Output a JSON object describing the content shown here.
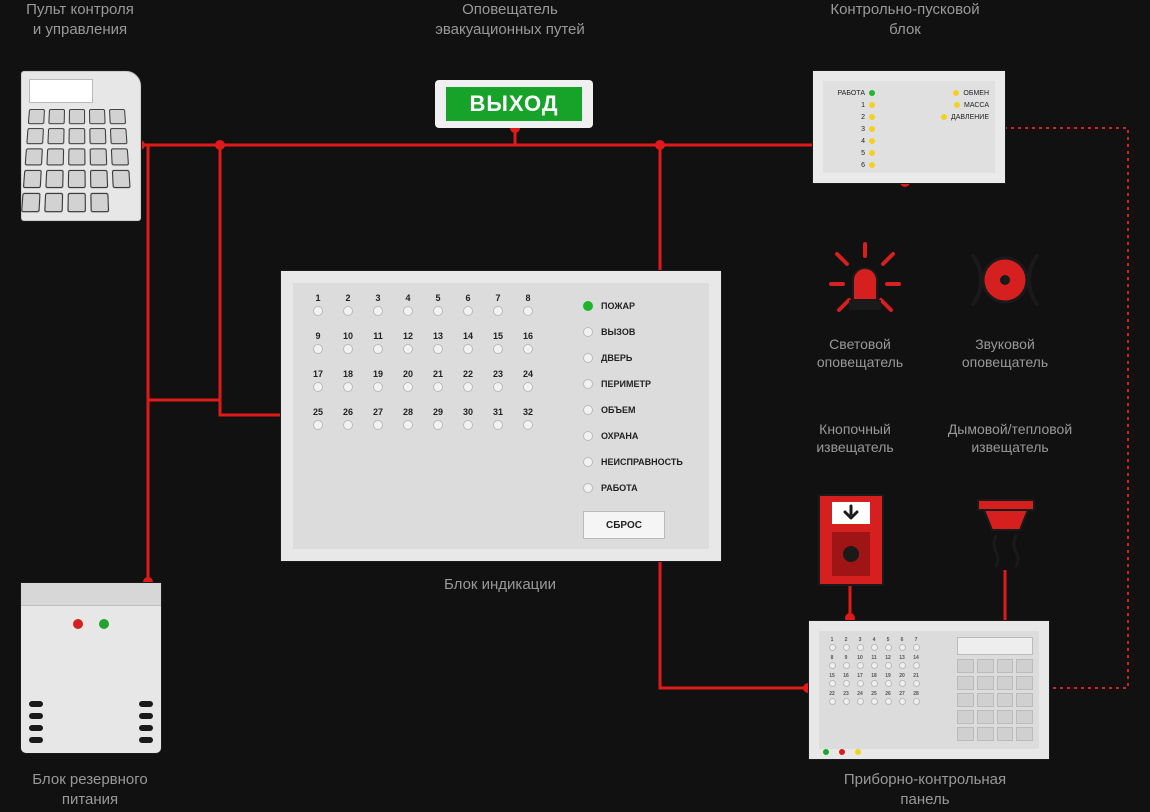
{
  "labels": {
    "control": "Пульт контроля\nи управления",
    "exit": "Оповещатель\nэвакуационных путей",
    "trigger": "Контрольно-пусковой\nблок",
    "indication": "Блок индикации",
    "backup": "Блок резервного\nпитания",
    "light_alarm": "Световой\nоповещатель",
    "sound_alarm": "Звуковой\nоповещатель",
    "callpoint": "Кнопочный\nизвещатель",
    "smoke": "Дымовой/тепловой\nизвещатель",
    "ctrl_panel": "Приборно-контрольная\nпанель"
  },
  "exit_sign": {
    "text": "ВЫХОД"
  },
  "trigger_block": {
    "left_labels": [
      "РАБОТА",
      "1",
      "2",
      "3",
      "4",
      "5",
      "6"
    ],
    "right_labels": [
      "ОБМЕН",
      "МАССА",
      "ДАВЛЕНИЕ"
    ]
  },
  "indication_block": {
    "cells": [
      "1",
      "2",
      "3",
      "4",
      "5",
      "6",
      "7",
      "8",
      "9",
      "10",
      "11",
      "12",
      "13",
      "14",
      "15",
      "16",
      "17",
      "18",
      "19",
      "20",
      "21",
      "22",
      "23",
      "24",
      "25",
      "26",
      "27",
      "28",
      "29",
      "30",
      "31",
      "32"
    ],
    "status": [
      "ПОЖАР",
      "ВЫЗОВ",
      "ДВЕРЬ",
      "ПЕРИМЕТР",
      "ОБЪЕМ",
      "ОХРАНА",
      "НЕИСПРАВНОСТЬ",
      "РАБОТА"
    ],
    "status_active_index": 0,
    "reset": "СБРОС"
  },
  "ctrl_panel": {
    "cells": [
      "1",
      "2",
      "3",
      "4",
      "5",
      "6",
      "7",
      "8",
      "9",
      "10",
      "11",
      "12",
      "13",
      "14",
      "15",
      "16",
      "17",
      "18",
      "19",
      "20",
      "21",
      "22",
      "23",
      "24",
      "25",
      "26",
      "27",
      "28"
    ]
  },
  "colors": {
    "wire": "#e01919",
    "wire_dotted": "#d61f1f",
    "panel_bg": "#e8e8e8"
  }
}
